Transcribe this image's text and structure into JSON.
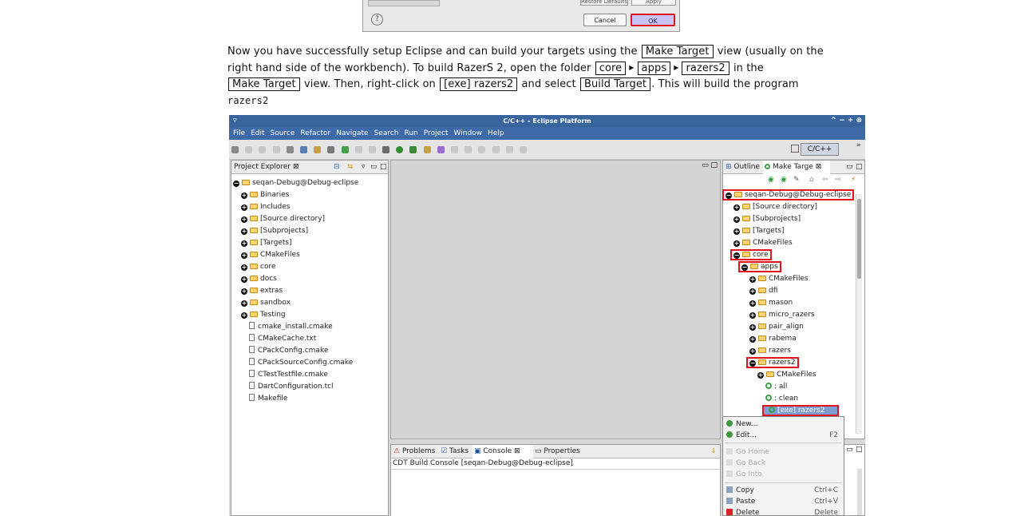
{
  "dialog": {
    "restore_label": "Restore Defaults",
    "apply_label": "Apply",
    "help_label": "?",
    "cancel_label": "Cancel",
    "ok_label": "OK"
  },
  "paragraph": {
    "t1": "Now you have successfully setup Eclipse and can build your targets using the",
    "k1": "Make Target",
    "t2": "view (usually on the right hand side of the workbench). To build RazerS 2, open the folder",
    "k2": "core",
    "k3": "apps",
    "k4": "razers2",
    "t3": "in the",
    "k5": "Make Target",
    "t4": "view. Then, right-click on",
    "k6": "[exe] razers2",
    "t5": "and select",
    "k7": "Build Target",
    "t6": ". This will build the program",
    "code": "razers2"
  },
  "eclipse": {
    "title": "C/C++ - Eclipse Platform",
    "window_controls": "^ − + ⊗",
    "menu": [
      "File",
      "Edit",
      "Source",
      "Refactor",
      "Navigate",
      "Search",
      "Run",
      "Project",
      "Window",
      "Help"
    ],
    "perspective": "C/C++",
    "project_explorer": {
      "tab": "Project Explorer",
      "items": [
        {
          "label": "seqan-Debug@Debug-eclipse",
          "kind": "root"
        },
        {
          "label": "Binaries",
          "kind": "plus"
        },
        {
          "label": "Includes",
          "kind": "plus"
        },
        {
          "label": "[Source directory]",
          "kind": "plus"
        },
        {
          "label": "[Subprojects]",
          "kind": "plus"
        },
        {
          "label": "[Targets]",
          "kind": "plus"
        },
        {
          "label": "CMakeFiles",
          "kind": "plus"
        },
        {
          "label": "core",
          "kind": "plus"
        },
        {
          "label": "docs",
          "kind": "plus"
        },
        {
          "label": "extras",
          "kind": "plus"
        },
        {
          "label": "sandbox",
          "kind": "plus"
        },
        {
          "label": "Testing",
          "kind": "plus"
        },
        {
          "label": "cmake_install.cmake",
          "kind": "file"
        },
        {
          "label": "CMakeCache.txt",
          "kind": "file"
        },
        {
          "label": "CPackConfig.cmake",
          "kind": "file"
        },
        {
          "label": "CPackSourceConfig.cmake",
          "kind": "file"
        },
        {
          "label": "CTestTestfile.cmake",
          "kind": "file"
        },
        {
          "label": "DartConfiguration.tcl",
          "kind": "file"
        },
        {
          "label": "Makefile",
          "kind": "file"
        }
      ]
    },
    "outline_tab": "Outline",
    "make_target_tab": "Make Targe",
    "make_target_items": [
      {
        "label": "seqan-Debug@Debug-eclipse",
        "indent": 0,
        "kind": "minus",
        "hl": true
      },
      {
        "label": "[Source directory]",
        "indent": 1,
        "kind": "plus"
      },
      {
        "label": "[Subprojects]",
        "indent": 1,
        "kind": "plus"
      },
      {
        "label": "[Targets]",
        "indent": 1,
        "kind": "plus"
      },
      {
        "label": "CMakeFiles",
        "indent": 1,
        "kind": "plus"
      },
      {
        "label": "core",
        "indent": 1,
        "kind": "minus",
        "hl": true
      },
      {
        "label": "apps",
        "indent": 2,
        "kind": "minus",
        "hl": true
      },
      {
        "label": "CMakeFiles",
        "indent": 3,
        "kind": "plus"
      },
      {
        "label": "dfi",
        "indent": 3,
        "kind": "plus"
      },
      {
        "label": "mason",
        "indent": 3,
        "kind": "plus"
      },
      {
        "label": "micro_razers",
        "indent": 3,
        "kind": "plus"
      },
      {
        "label": "pair_align",
        "indent": 3,
        "kind": "plus"
      },
      {
        "label": "rabema",
        "indent": 3,
        "kind": "plus"
      },
      {
        "label": "razers",
        "indent": 3,
        "kind": "plus"
      },
      {
        "label": "razers2",
        "indent": 3,
        "kind": "minus",
        "hl": true
      },
      {
        "label": "CMakeFiles",
        "indent": 4,
        "kind": "plus"
      },
      {
        "label": ": all",
        "indent": 5,
        "kind": "target"
      },
      {
        "label": ": clean",
        "indent": 5,
        "kind": "target"
      },
      {
        "label": "[exe] razers2",
        "indent": 5,
        "kind": "target",
        "hl": true,
        "sel": true
      }
    ],
    "bottom_tabs": [
      "Problems",
      "Tasks",
      "Console",
      "Properties"
    ],
    "console_text": "CDT Build Console [seqan-Debug@Debug-eclipse]",
    "context_menu": [
      {
        "label": "New...",
        "accel": "",
        "disabled": false
      },
      {
        "label": "Edit...",
        "accel": "F2",
        "disabled": false
      },
      {
        "label": "Go Home",
        "accel": "",
        "disabled": true
      },
      {
        "label": "Go Back",
        "accel": "",
        "disabled": true
      },
      {
        "label": "Go Into",
        "accel": "",
        "disabled": true
      },
      {
        "label": "Copy",
        "accel": "Ctrl+C",
        "disabled": false
      },
      {
        "label": "Paste",
        "accel": "Ctrl+V",
        "disabled": false
      },
      {
        "label": "Delete",
        "accel": "Delete",
        "disabled": false
      }
    ]
  }
}
